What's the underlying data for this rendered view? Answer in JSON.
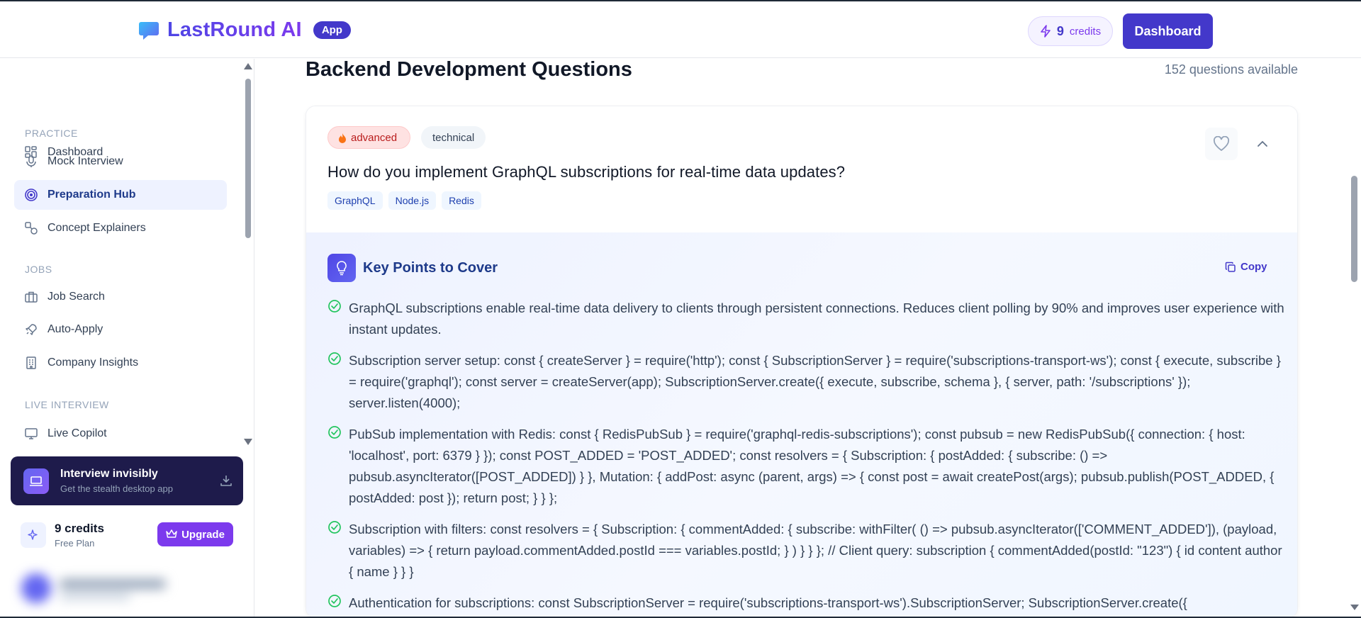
{
  "header": {
    "brand": "LastRound AI",
    "badge": "App",
    "credits_count": "9",
    "credits_label": "credits",
    "dashboard_button": "Dashboard"
  },
  "sidebar": {
    "top_item": "Dashboard",
    "sections": [
      {
        "label": "PRACTICE",
        "items": [
          "Mock Interview",
          "Preparation Hub",
          "Concept Explainers"
        ]
      },
      {
        "label": "JOBS",
        "items": [
          "Job Search",
          "Auto-Apply",
          "Company Insights"
        ]
      },
      {
        "label": "LIVE INTERVIEW",
        "items": [
          "Live Copilot"
        ]
      }
    ],
    "active_item": "Preparation Hub",
    "promo": {
      "title": "Interview invisibly",
      "subtitle": "Get the stealth desktop app"
    },
    "credits": {
      "count": "9 credits",
      "plan": "Free Plan",
      "upgrade": "Upgrade"
    }
  },
  "main": {
    "title": "Backend Development Questions",
    "available": "152 questions available",
    "card": {
      "difficulty": "advanced",
      "category": "technical",
      "question": "How do you implement GraphQL subscriptions for real-time data updates?",
      "tags": [
        "GraphQL",
        "Node.js",
        "Redis"
      ],
      "key_points_title": "Key Points to Cover",
      "copy_label": "Copy",
      "points": [
        "GraphQL subscriptions enable real-time data delivery to clients through persistent connections. Reduces client polling by 90% and improves user experience with instant updates.",
        "Subscription server setup: const { createServer } = require('http'); const { SubscriptionServer } = require('subscriptions-transport-ws'); const { execute, subscribe } = require('graphql'); const server = createServer(app); SubscriptionServer.create({ execute, subscribe, schema }, { server, path: '/subscriptions' }); server.listen(4000);",
        "PubSub implementation with Redis: const { RedisPubSub } = require('graphql-redis-subscriptions'); const pubsub = new RedisPubSub({ connection: { host: 'localhost', port: 6379 } }); const POST_ADDED = 'POST_ADDED'; const resolvers = { Subscription: { postAdded: { subscribe: () => pubsub.asyncIterator([POST_ADDED]) } }, Mutation: { addPost: async (parent, args) => { const post = await createPost(args); pubsub.publish(POST_ADDED, { postAdded: post }); return post; } } };",
        "Subscription with filters: const resolvers = { Subscription: { commentAdded: { subscribe: withFilter( () => pubsub.asyncIterator(['COMMENT_ADDED']), (payload, variables) => { return payload.commentAdded.postId === variables.postId; } ) } } }; // Client query: subscription { commentAdded(postId: \"123\") { id content author { name } } }",
        "Authentication for subscriptions: const SubscriptionServer = require('subscriptions-transport-ws').SubscriptionServer; SubscriptionServer.create({"
      ]
    }
  },
  "colors": {
    "accent": "#4338ca",
    "brand_gradient_start": "#4f46e5",
    "brand_gradient_end": "#7c3aed",
    "danger_tag": "#b91c1c"
  }
}
